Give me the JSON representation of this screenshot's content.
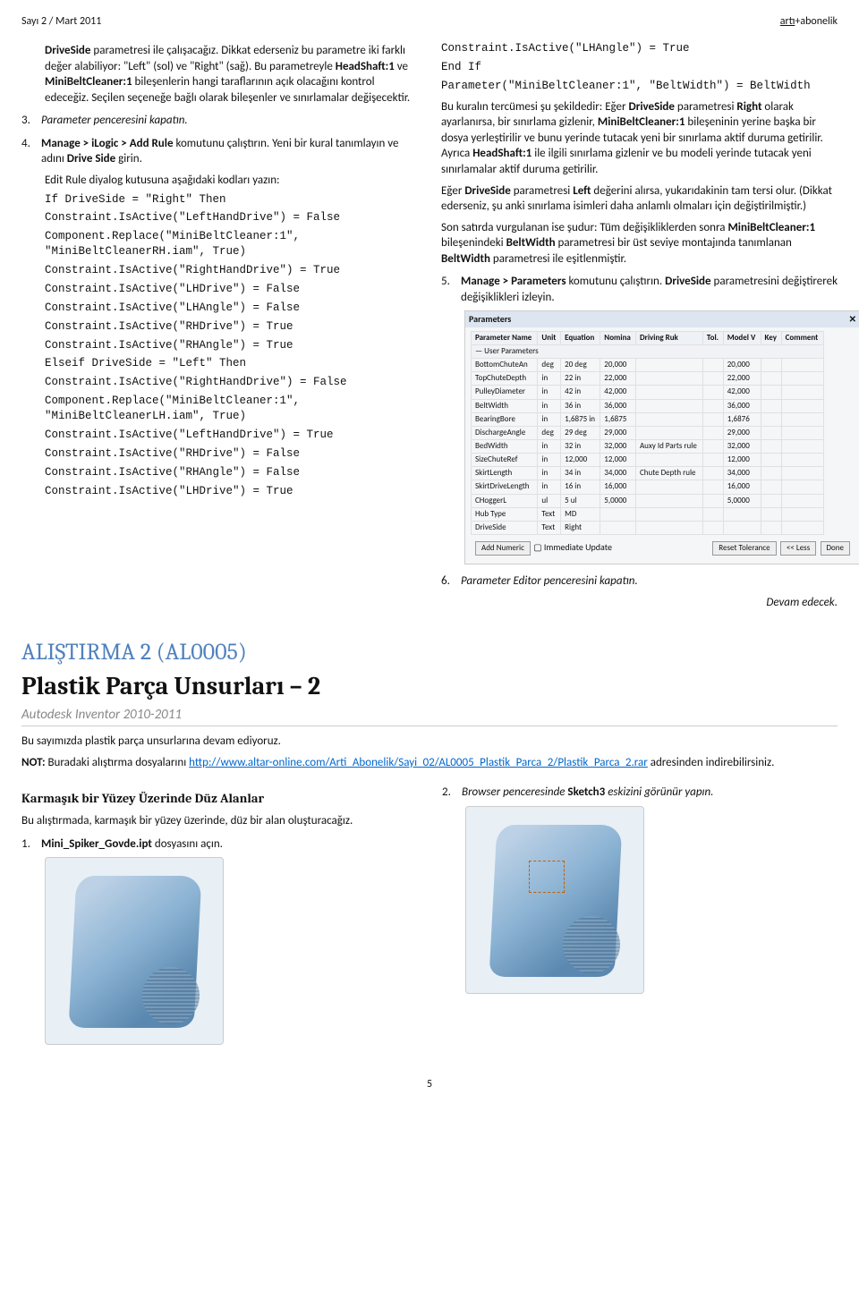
{
  "header": {
    "issue": "Sayı 2 / Mart 2011",
    "brand_pre": "artı",
    "brand_post": "abonelik"
  },
  "left": {
    "p1": {
      "t1": "DriveSide",
      "t2": " parametresi ile çalışacağız. Dikkat ederseniz bu parametre iki farklı değer alabiliyor: \"Left\" (sol) ve \"Right\" (sağ). Bu parametreyle ",
      "t3": "HeadShaft:1",
      "t4": " ve ",
      "t5": "MiniBeltCleaner:1",
      "t6": " bileşenlerin hangi taraflarının açık olacağını kontrol edeceğiz. Seçilen seçeneğe bağlı olarak bileşenler ve sınırlamalar değişecektir."
    },
    "s3_n": "3.",
    "s3_t": "Parameter penceresini kapatın.",
    "s4_n": "4.",
    "s4_a": "Manage > iLogic > Add Rule",
    "s4_b": " komutunu çalıştırın. Yeni bir kural tanımlayın ve adını ",
    "s4_c": "Drive Side",
    "s4_d": " girin.",
    "edit_t": "Edit Rule diyalog kutusuna aşağıdaki kodları yazın:",
    "code": [
      "If DriveSide = \"Right\" Then",
      "Constraint.IsActive(\"LeftHandDrive\") = False",
      "Component.Replace(\"MiniBeltCleaner:1\", \"MiniBeltCleanerRH.iam\", True)",
      "Constraint.IsActive(\"RightHandDrive\") = True",
      "Constraint.IsActive(\"LHDrive\") = False",
      "Constraint.IsActive(\"LHAngle\") = False",
      "Constraint.IsActive(\"RHDrive\") = True",
      "Constraint.IsActive(\"RHAngle\") = True",
      "Elseif DriveSide = \"Left\" Then",
      "Constraint.IsActive(\"RightHandDrive\") = False",
      "Component.Replace(\"MiniBeltCleaner:1\", \"MiniBeltCleanerLH.iam\", True)",
      "Constraint.IsActive(\"LeftHandDrive\") = True",
      "Constraint.IsActive(\"RHDrive\") = False",
      "Constraint.IsActive(\"RHAngle\") = False",
      "Constraint.IsActive(\"LHDrive\") = True"
    ]
  },
  "right": {
    "code2": [
      "Constraint.IsActive(\"LHAngle\") = True",
      "End If",
      "Parameter(\"MiniBeltCleaner:1\", \"BeltWidth\") = BeltWidth"
    ],
    "p2": {
      "a": "Bu kuralın tercümesi şu şekildedir: Eğer ",
      "b": "DriveSide",
      "c": " parametresi ",
      "d": "Right",
      "e": " olarak ayarlanırsa, bir sınırlama gizlenir, ",
      "f": "MiniBeltCleaner:1",
      "g": " bileşeninin yerine başka bir dosya yerleştirilir ve bunu yerinde tutacak yeni bir sınırlama aktif duruma getirilir. Ayrıca ",
      "h": "HeadShaft:1",
      "i": " ile ilgili sınırlama gizlenir ve bu modeli yerinde tutacak yeni sınırlamalar aktif duruma getirilir."
    },
    "p3": {
      "a": "Eğer ",
      "b": "DriveSide",
      "c": " parametresi ",
      "d": "Left",
      "e": " değerini alırsa, yukarıdakinin tam tersi olur. (Dikkat ederseniz, şu anki sınırlama isimleri daha anlamlı olmaları için değiştirilmiştir.)"
    },
    "p4": {
      "a": "Son satırda vurgulanan ise şudur: Tüm değişikliklerden sonra ",
      "b": "MiniBeltCleaner:1",
      "c": " bileşenindeki ",
      "d": "BeltWidth",
      "e": " parametresi bir üst seviye montajında tanımlanan ",
      "f": "BeltWidth",
      "g": " parametresi ile eşitlenmiştir."
    },
    "s5_n": "5.",
    "s5_a": "Manage > Parameters",
    "s5_b": " komutunu çalıştırın. ",
    "s5_c": "DriveSide",
    "s5_d": " parametresini değiştirerek değişiklikleri izleyin.",
    "table": {
      "title": "Parameters",
      "headers": [
        "Parameter Name",
        "Unit",
        "Equation",
        "Nomina",
        "Driving Ruk",
        "Tol.",
        "Model V",
        "Key",
        "Comment"
      ],
      "group": "— User Parameters",
      "rows": [
        [
          "BottomChuteAn",
          "deg",
          "20 deg",
          "20,000",
          "",
          "",
          "20,000",
          "",
          ""
        ],
        [
          "TopChuteDepth",
          "in",
          "22 in",
          "22,000",
          "",
          "",
          "22,000",
          "",
          ""
        ],
        [
          "PulleyDiameter",
          "in",
          "42 in",
          "42,000",
          "",
          "",
          "42,000",
          "",
          ""
        ],
        [
          "BeltWidth",
          "in",
          "36 in",
          "36,000",
          "",
          "",
          "36,000",
          "",
          ""
        ],
        [
          "BearingBore",
          "in",
          "1,6875 in",
          "1,6875",
          "",
          "",
          "1,6876",
          "",
          ""
        ],
        [
          "DischargeAngle",
          "deg",
          "29 deg",
          "29,000",
          "",
          "",
          "29,000",
          "",
          ""
        ],
        [
          "BedWidth",
          "in",
          "32 in",
          "32,000",
          "Auxy Id Parts rule",
          "",
          "32,000",
          "",
          ""
        ],
        [
          "SizeChuteRef",
          "in",
          "12,000",
          "12,000",
          "",
          "",
          "12,000",
          "",
          ""
        ],
        [
          "SkirtLength",
          "in",
          "34 in",
          "34,000",
          "Chute Depth rule",
          "",
          "34,000",
          "",
          ""
        ],
        [
          "SkirtDriveLength",
          "in",
          "16 in",
          "16,000",
          "",
          "",
          "16,000",
          "",
          ""
        ],
        [
          "CHoggerL",
          "ul",
          "5 ul",
          "5,0000",
          "",
          "",
          "5,0000",
          "",
          ""
        ],
        [
          "Hub Type",
          "Text",
          "MD",
          "",
          "",
          "",
          "",
          "",
          ""
        ],
        [
          "DriveSide",
          "Text",
          "Right",
          "",
          "",
          "",
          "",
          "",
          ""
        ]
      ],
      "btn_add": "Add Numeric",
      "chk_update": "Immediate Update",
      "btn_reset": "Reset Tolerance",
      "btn_less": "<< Less",
      "btn_done": "Done"
    },
    "s6_n": "6.",
    "s6_t": "Parameter Editor penceresini kapatın.",
    "cont": "Devam edecek."
  },
  "bottom": {
    "h1": "ALIŞTIRMA 2 (AL0005)",
    "h2": "Plastik Parça Unsurları – 2",
    "sub": "Autodesk Inventor 2010-2011",
    "p1": "Bu sayımızda plastik parça unsurlarına devam ediyoruz.",
    "note_a": "NOT:",
    "note_b": " Buradaki alıştırma dosyalarını ",
    "link": "http://www.altar-online.com/Arti_Abonelik/Sayi_02/AL0005_Plastik_Parca_2/Plastik_Parca_2.rar",
    "note_c": " adresinden indirebilirsiniz.",
    "left": {
      "h": "Karmaşık bir Yüzey Üzerinde Düz Alanlar",
      "p": "Bu alıştırmada, karmaşık bir yüzey üzerinde, düz bir alan oluşturacağız.",
      "s1_n": "1.",
      "s1_a": "Mini_Spiker_Govde.ipt",
      "s1_b": " dosyasını açın."
    },
    "right": {
      "s2_n": "2.",
      "s2_a": "Browser penceresinde ",
      "s2_b": "Sketch3",
      "s2_c": " eskizini görünür yapın."
    }
  },
  "footer": {
    "page": "5"
  }
}
